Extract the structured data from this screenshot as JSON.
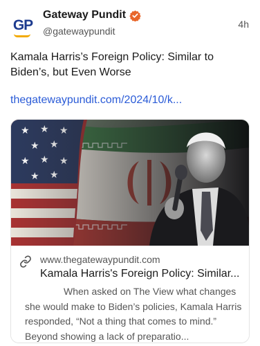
{
  "account": {
    "avatar_text": "GP",
    "display_name": "Gateway Pundit",
    "handle": "@gatewaypundit",
    "verified_icon": "verified-badge-icon",
    "time": "4h"
  },
  "post": {
    "text": "Kamala Harris’s Foreign Policy: Similar to Biden’s, but Even Worse",
    "link": "thegatewaypundit.com/2024/10/k..."
  },
  "card": {
    "link_icon": "link-icon",
    "domain": "www.thegatewaypundit.com",
    "title": "Kamala Harris's Foreign Policy: Similar...",
    "description": "When asked on The View what changes she would make to Biden’s policies, Kamala Harris responded, “Not a thing that comes to mind.” Beyond showing a lack of preparatio...",
    "image_description_icon": "news-photo"
  },
  "colors": {
    "brand_blue": "#1d3b8f",
    "brand_gold": "#f2a900",
    "verified_orange": "#e8662b",
    "link_blue": "#2a5bd7"
  }
}
